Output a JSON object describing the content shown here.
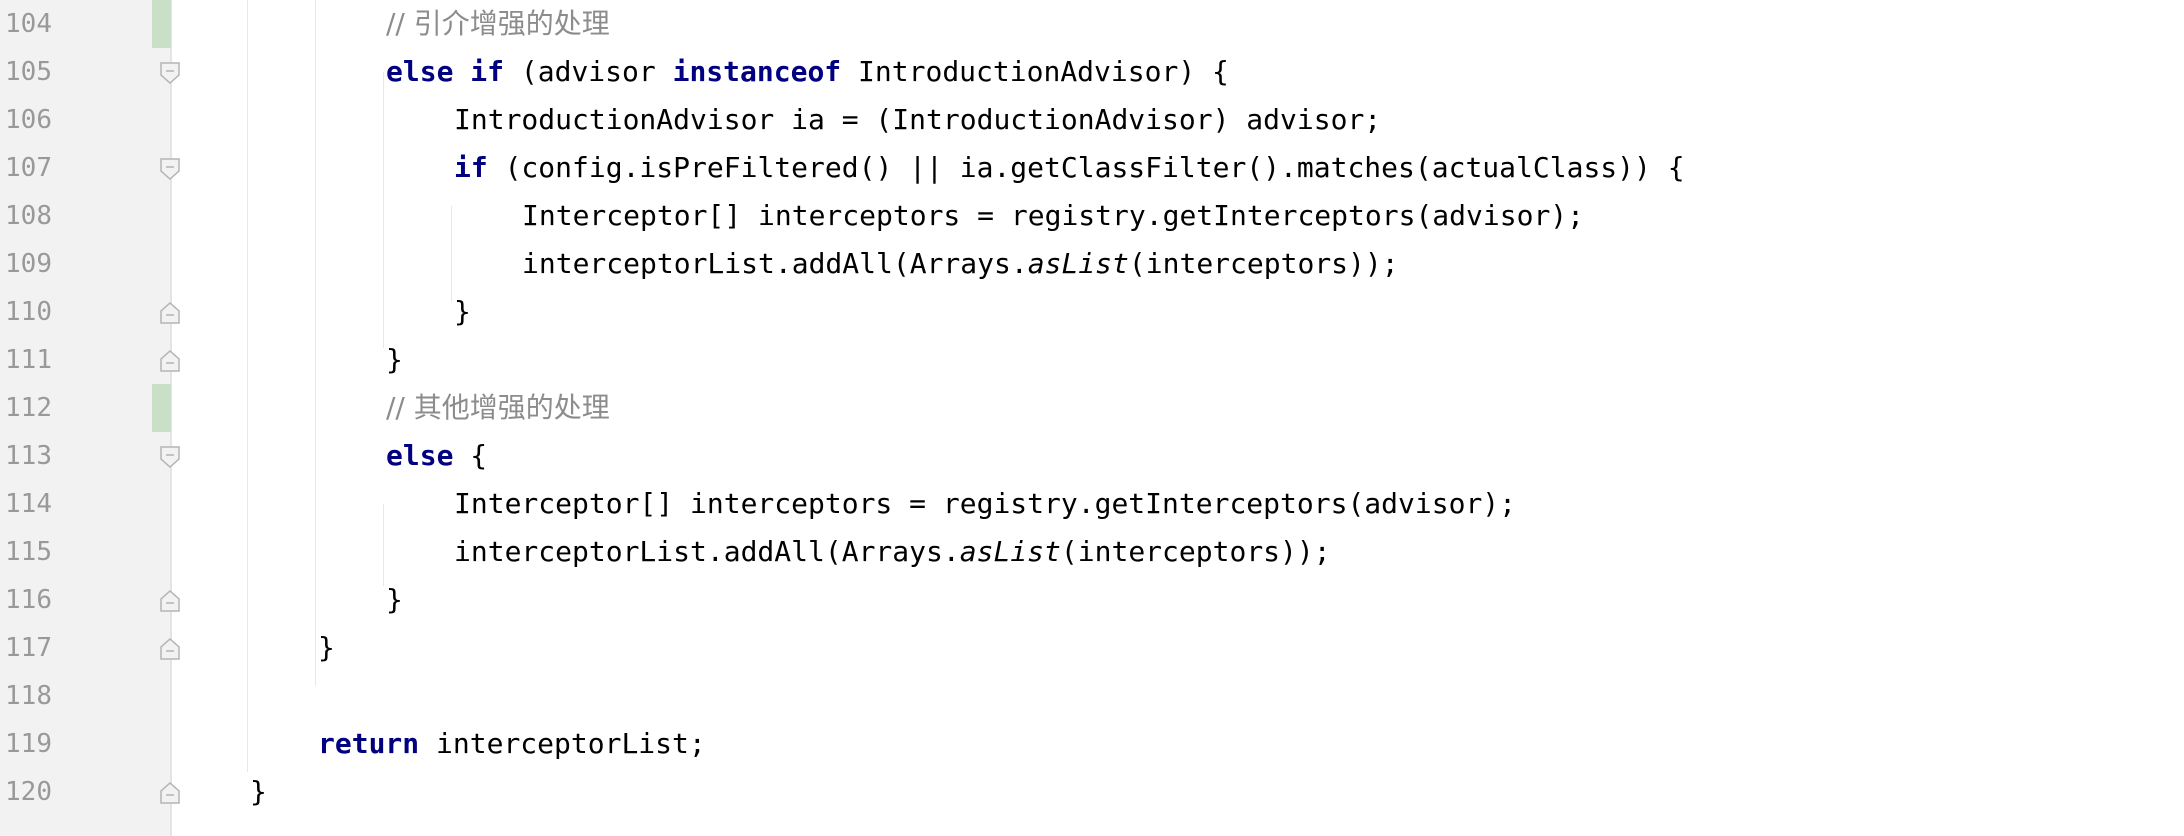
{
  "lines": [
    {
      "number": "104",
      "parts": [
        "// 引介增强的处理"
      ]
    },
    {
      "number": "105",
      "parts": [
        "else if",
        " (advisor ",
        "instanceof",
        " IntroductionAdvisor) {"
      ]
    },
    {
      "number": "106",
      "parts": [
        "IntroductionAdvisor ia = (IntroductionAdvisor) advisor;"
      ]
    },
    {
      "number": "107",
      "parts": [
        "if",
        " (config.isPreFiltered() || ia.getClassFilter().matches(actualClass)) {"
      ]
    },
    {
      "number": "108",
      "parts": [
        "Interceptor[] interceptors = registry.getInterceptors(advisor);"
      ]
    },
    {
      "number": "109",
      "parts": [
        "interceptorList.addAll(Arrays.",
        "asList",
        "(interceptors));"
      ]
    },
    {
      "number": "110",
      "parts": [
        "}"
      ]
    },
    {
      "number": "111",
      "parts": [
        "}"
      ]
    },
    {
      "number": "112",
      "parts": [
        "// 其他增强的处理"
      ]
    },
    {
      "number": "113",
      "parts": [
        "else",
        " {"
      ]
    },
    {
      "number": "114",
      "parts": [
        "Interceptor[] interceptors = registry.getInterceptors(advisor);"
      ]
    },
    {
      "number": "115",
      "parts": [
        "interceptorList.addAll(Arrays.",
        "asList",
        "(interceptors));"
      ]
    },
    {
      "number": "116",
      "parts": [
        "}"
      ]
    },
    {
      "number": "117",
      "parts": [
        "}"
      ]
    },
    {
      "number": "118",
      "parts": []
    },
    {
      "number": "119",
      "parts": [
        "return",
        " interceptorList;"
      ]
    },
    {
      "number": "120",
      "parts": [
        "}"
      ]
    }
  ],
  "colors": {
    "keyword": "#000080",
    "comment": "#8c8c8c",
    "text": "#000000",
    "line_number": "#999999",
    "gutter_background": "#f2f2f2",
    "change_marker": "#c9dfc7"
  }
}
